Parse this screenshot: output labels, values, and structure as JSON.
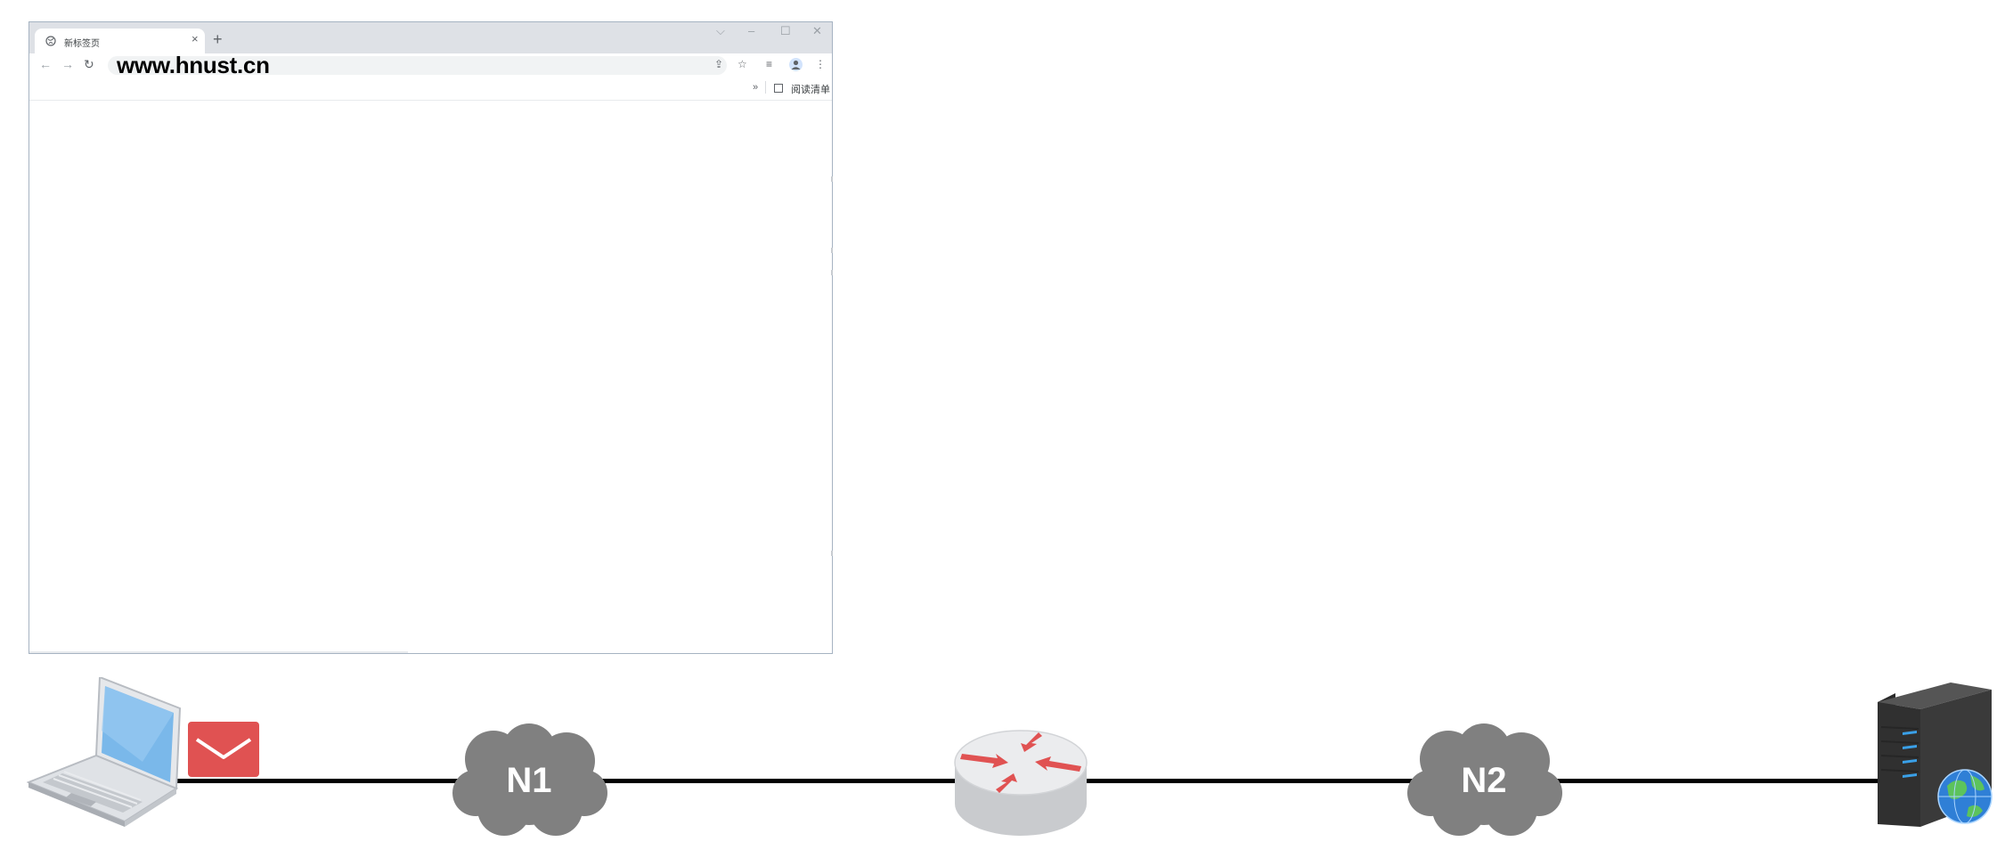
{
  "browser": {
    "tab": {
      "title": "新标签页",
      "close": "×"
    },
    "new_tab": "+",
    "window_controls": {
      "dropdown": "⌵",
      "minimize": "–",
      "maximize": "☐",
      "close": "✕"
    },
    "nav": {
      "back": "←",
      "forward": "→",
      "reload": "↻"
    },
    "address": {
      "url": "www.hnust.cn"
    },
    "toolbar_icons": {
      "share": "⇪",
      "bookmark_star": "☆",
      "reading_list": "≡",
      "menu": "⋮"
    },
    "bookmarks_bar": {
      "more": "»",
      "reading_list_label": "阅读清单"
    }
  },
  "diagram": {
    "clouds": [
      {
        "label": "N1"
      },
      {
        "label": "N2"
      }
    ],
    "icons": {
      "client": "laptop-icon",
      "message": "envelope-icon",
      "router": "router-icon",
      "server": "web-server-icon"
    },
    "colors": {
      "link": "#000000",
      "cloud": "#808080",
      "envelope": "#e05252",
      "router_arrows": "#e05252",
      "laptop_screen": "#7ab8ea",
      "server_body": "#3a3a3a",
      "server_led": "#3aa0e8"
    }
  }
}
